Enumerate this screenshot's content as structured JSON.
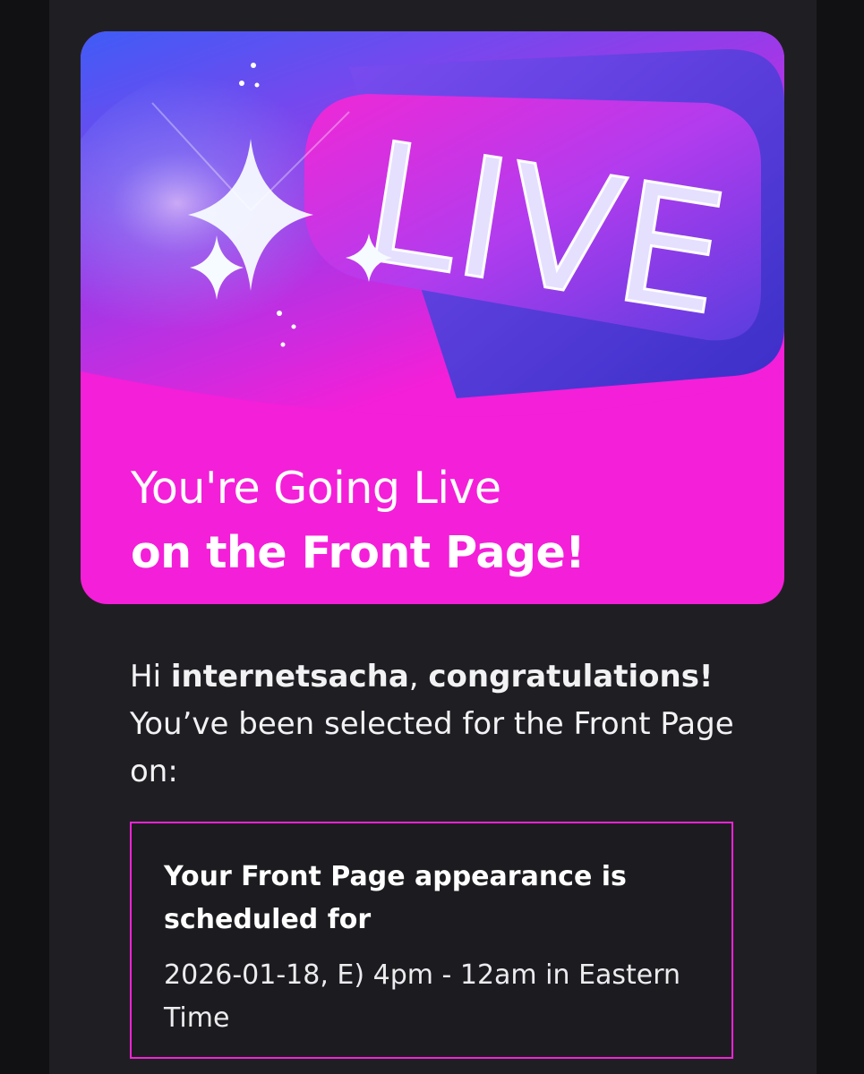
{
  "hero": {
    "badge_text": "LIVE",
    "title_line1": "You're Going Live",
    "title_line2": "on the Front Page!",
    "colors": {
      "background": "#f41fd8",
      "badge_top": "#c03bf5",
      "badge_text": "#e6e0ff"
    }
  },
  "greeting": {
    "hi": "Hi",
    "username": "internetsacha",
    "comma": ",",
    "congrats": "congratulations!",
    "body": "You’ve been selected for the Front Page on:"
  },
  "schedule": {
    "title": "Your Front Page appearance is scheduled for",
    "value": "2026-01-18, E) 4pm - 12am in Eastern Time",
    "border_color": "#f124d6"
  }
}
